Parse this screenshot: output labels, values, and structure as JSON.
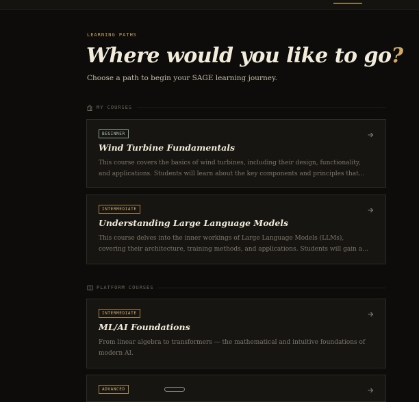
{
  "header": {
    "eyebrow": "LEARNING PATHS",
    "title": "Where would you like to go",
    "title_mark": "?",
    "subtitle": "Choose a path to begin your SAGE learning journey."
  },
  "my_courses": {
    "label": "MY COURSES",
    "icon": "puzzle-icon",
    "cards": [
      {
        "level": "BEGINNER",
        "title": "Wind Turbine Fundamentals",
        "description": "This course covers the basics of wind turbines, including their design, functionality, and applications. Students will learn about the key components and principles that enable win..."
      },
      {
        "level": "INTERMEDIATE",
        "title": "Understanding Large Language Models",
        "description": "This course delves into the inner workings of Large Language Models (LLMs), covering their architecture, training methods, and applications. Students will gain a comprehensive..."
      }
    ]
  },
  "platform_courses": {
    "label": "PLATFORM COURSES",
    "icon": "book-icon",
    "cards": [
      {
        "level": "INTERMEDIATE",
        "title": "ML/AI Foundations",
        "description": "From linear algebra to transformers — the mathematical and intuitive foundations of modern AI."
      },
      {
        "level": "ADVANCED"
      }
    ]
  },
  "colors": {
    "accent": "#cfa86a",
    "background": "#0d0c0a",
    "card": "#161512",
    "beginner": "#8aa58c"
  }
}
